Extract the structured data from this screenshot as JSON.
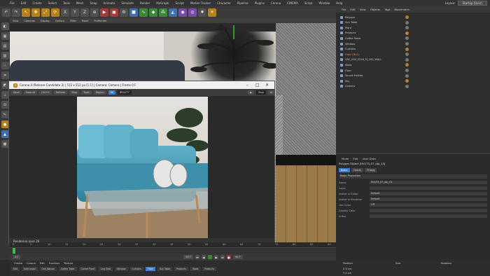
{
  "menubar": {
    "items": [
      "File",
      "Edit",
      "Create",
      "Select",
      "Tools",
      "Mesh",
      "Snap",
      "Animate",
      "Simulate",
      "Render",
      "MoGraph",
      "Sculpt",
      "Motion Tracker",
      "Character",
      "Pipeline",
      "Plugins",
      "Corona",
      "CINEMA",
      "Script",
      "Window",
      "Help"
    ],
    "layout_label": "Layout:",
    "layout_value": "Startup (User)"
  },
  "viewport_menu": [
    "View",
    "Cameras",
    "Display",
    "Options",
    "Filter",
    "Panel",
    "ProRender"
  ],
  "render_window": {
    "title": "Corona 4 (Release Candidate 3) | 512 x 512 px [1:1] | Camera: Camera | Frame 0 F",
    "toolbar": [
      "Save",
      "Save all",
      "Copy",
      "Refresh",
      "Stop",
      "Tools",
      "Region",
      "Ctrl+C",
      "BEAUTY"
    ],
    "region_label": "Region",
    "pass_label": "BEAUTY",
    "stop_label": "Stop",
    "status": "Rendering pass 26"
  },
  "object_manager": {
    "menu": [
      "File",
      "Edit",
      "View",
      "Objects",
      "Tags",
      "Bookmarks"
    ],
    "objects": [
      "Polygon",
      "Sun Table",
      "Plant",
      "Products",
      "Coffee Table",
      "Window",
      "Curtains",
      "Floor (HV1)",
      "VRC_003_S216_PJ_100_WALL",
      "Walls",
      "Floor",
      "Sound Emitter",
      "Sky",
      "Camera"
    ]
  },
  "attribute_manager": {
    "menu": [
      "Mode",
      "Edit",
      "User Data"
    ],
    "title": "Polygon Object [HV1T3_07_obj_13]",
    "tabs": [
      "Basic",
      "Coord.",
      "Phong"
    ],
    "section": "Basic Properties",
    "rows": [
      {
        "k": "Name",
        "v": "HV1T3_07_obj_13"
      },
      {
        "k": "Layer",
        "v": ""
      },
      {
        "k": "Visible in Editor",
        "v": "Default"
      },
      {
        "k": "Visible in Renderer",
        "v": "Default"
      },
      {
        "k": "Use Color",
        "v": "Off"
      },
      {
        "k": "Display Color",
        "v": ""
      },
      {
        "k": "X-Ray",
        "v": ""
      }
    ]
  },
  "timeline": {
    "ticks": [
      "0",
      "5",
      "10",
      "15",
      "20",
      "25",
      "30",
      "35",
      "40",
      "45",
      "50",
      "55",
      "60",
      "65",
      "70",
      "75",
      "80",
      "85",
      "90"
    ],
    "start": "0 F",
    "current": "90 F",
    "end": "90 F"
  },
  "material_manager": {
    "menu": [
      "Create",
      "Corona",
      "Edit",
      "Function",
      "Texture"
    ],
    "materials": [
      "Mat",
      "Sofa wood",
      "Cell_Nature",
      "Coffee Table",
      "Corner Plant",
      "Leg Sofa",
      "Window",
      "Curtains",
      "Floor",
      "Sun Table",
      "Products",
      "Walls",
      "Products"
    ],
    "selected": "Floor"
  },
  "coords": {
    "labels": [
      "Position",
      "Size",
      "Rotation"
    ],
    "x": "X 0 cm",
    "y": "Y 0 cm"
  }
}
